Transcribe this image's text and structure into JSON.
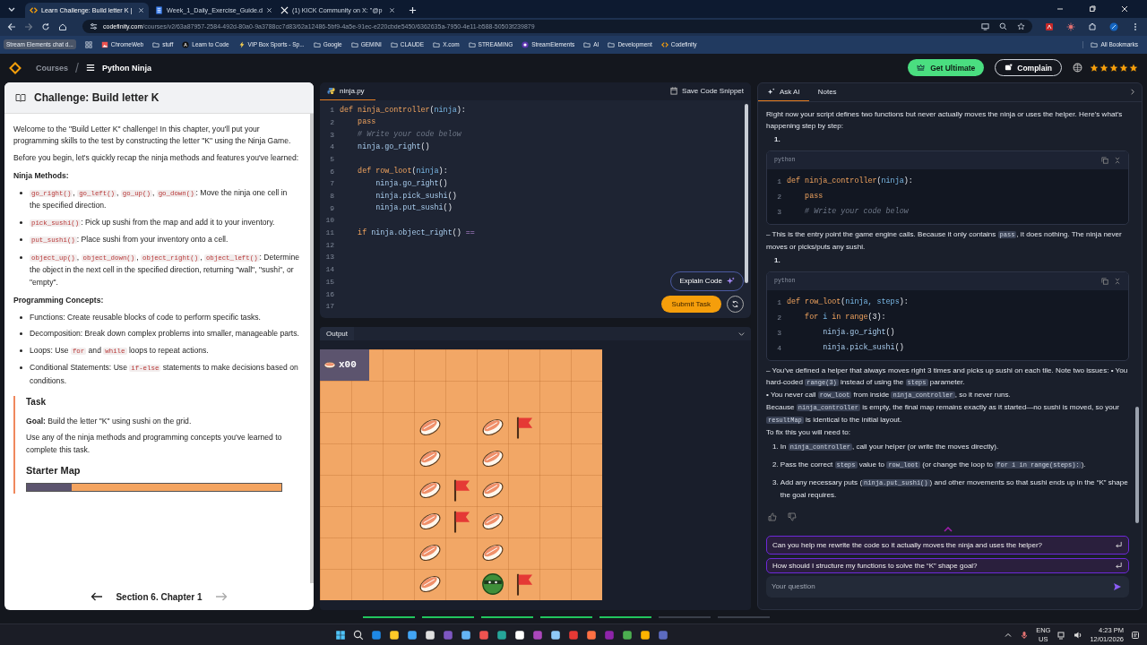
{
  "browser": {
    "tabs": [
      {
        "title": "Learn Challenge: Build letter K |",
        "selected": true,
        "kind": "code"
      },
      {
        "title": "Week_1_Daily_Exercise_Guide.d",
        "selected": false,
        "kind": "doc"
      },
      {
        "title": "(1) KICK Community on X: \"@p",
        "selected": false,
        "kind": "x"
      }
    ],
    "url": {
      "host": "codefinity.com",
      "path": "/courses/v2/63a87957-2584-492d-80a0-9a3788cc7d83/62a12486-5bf9-4a5e-91ec-e220cbde5450/6362635a-7950-4e11-b588-50503f239879"
    },
    "bookmarks": [
      {
        "label": "Stream Elements chat d...",
        "kind": "chip"
      },
      {
        "kind": "apps"
      },
      {
        "label": "ChromeWeb",
        "kind": "site"
      },
      {
        "label": "stuff",
        "kind": "folder"
      },
      {
        "label": "Learn to Code",
        "kind": "letter"
      },
      {
        "label": "VIP Box Sports - Sp...",
        "kind": "bolt"
      },
      {
        "label": "Google",
        "kind": "folder"
      },
      {
        "label": "GEMINI",
        "kind": "folder"
      },
      {
        "label": "CLAUDE",
        "kind": "folder"
      },
      {
        "label": "X.com",
        "kind": "folder"
      },
      {
        "label": "STREAMING",
        "kind": "folder"
      },
      {
        "label": "StreamElements",
        "kind": "circle"
      },
      {
        "label": "AI",
        "kind": "folder"
      },
      {
        "label": "Development",
        "kind": "folder"
      },
      {
        "label": "Codefinity",
        "kind": "code"
      }
    ],
    "all_bookmarks": "All Bookmarks"
  },
  "header": {
    "courses": "Courses",
    "separator": "/",
    "course": "Python Ninja",
    "ultimate": "Get Ultimate",
    "complain": "Complain",
    "stars": 5
  },
  "lesson": {
    "title": "Challenge: Build letter K",
    "blocks": [
      {
        "kind": "p",
        "parts": [
          {
            "text": "Welcome to the \"Build Letter K\" challenge! In this chapter, you'll put your programming skills to the test by constructing the letter \"K\" using the Ninja Game."
          }
        ]
      },
      {
        "kind": "p",
        "parts": [
          {
            "text": "Before you begin, let's quickly recap the ninja methods and features you've learned:"
          }
        ]
      },
      {
        "kind": "h",
        "parts": [
          {
            "text": "Ninja Methods:"
          }
        ]
      },
      {
        "kind": "li",
        "parts": [
          {
            "code": "go_right()"
          },
          {
            "text": ", "
          },
          {
            "code": "go_left()"
          },
          {
            "text": ", "
          },
          {
            "code": "go_up()"
          },
          {
            "text": ", "
          },
          {
            "code": "go_down()"
          },
          {
            "text": ": Move the ninja one cell in the specified direction."
          }
        ]
      },
      {
        "kind": "li",
        "parts": [
          {
            "code": "pick_sushi()"
          },
          {
            "text": ": Pick up sushi from the map and add it to your inventory."
          }
        ]
      },
      {
        "kind": "li",
        "parts": [
          {
            "code": "put_sushi()"
          },
          {
            "text": ": Place sushi from your inventory onto a cell."
          }
        ]
      },
      {
        "kind": "li",
        "parts": [
          {
            "code": "object_up()"
          },
          {
            "text": ", "
          },
          {
            "code": "object_down()"
          },
          {
            "text": ", "
          },
          {
            "code": "object_right()"
          },
          {
            "text": ", "
          },
          {
            "code": "object_left()"
          },
          {
            "text": ": Determine the object in the next cell in the specified direction, returning \"wall\", \"sushi\", or \"empty\"."
          }
        ]
      },
      {
        "kind": "h",
        "parts": [
          {
            "text": "Programming Concepts:"
          }
        ]
      },
      {
        "kind": "li",
        "parts": [
          {
            "text": "Functions: Create reusable blocks of code to perform specific tasks."
          }
        ]
      },
      {
        "kind": "li",
        "parts": [
          {
            "text": "Decomposition: Break down complex problems into smaller, manageable parts."
          }
        ]
      },
      {
        "kind": "li",
        "parts": [
          {
            "text": "Loops: Use "
          },
          {
            "code": "for"
          },
          {
            "text": " and "
          },
          {
            "code": "while"
          },
          {
            "text": " loops to repeat actions."
          }
        ]
      },
      {
        "kind": "li",
        "parts": [
          {
            "text": "Conditional Statements: Use "
          },
          {
            "code": "if-else"
          },
          {
            "text": " statements to make decisions based on conditions."
          }
        ]
      }
    ],
    "task": {
      "title": "Task",
      "goal": "**Goal:** Build the letter \"K\" using sushi on the grid.",
      "text": "Use any of the ninja methods and programming concepts you've learned to complete this task.",
      "map_title": "Starter Map"
    },
    "nav": {
      "label": "Section 6. Chapter 1",
      "prev_disabled": false,
      "next_disabled": true
    }
  },
  "editor": {
    "file": "ninja.py",
    "save": "Save Code Snippet",
    "explain": "Explain Code",
    "submit": "Submit Task",
    "lines": [
      {
        "n": "1",
        "code": [
          {
            "kind": "kw",
            "text": "def "
          },
          {
            "kind": "fn",
            "text": "ninja_controller"
          },
          {
            "kind": "p",
            "text": "("
          },
          {
            "kind": "var",
            "text": "ninja"
          },
          {
            "kind": "p",
            "text": "):"
          }
        ]
      },
      {
        "n": "2",
        "code": [
          {
            "kind": "kw",
            "text": "    pass"
          }
        ]
      },
      {
        "n": "3",
        "code": [
          {
            "kind": "cm",
            "text": "    # Write your code below"
          }
        ]
      },
      {
        "n": "4",
        "code": [
          {
            "kind": "call",
            "text": "    ninja.go_right"
          },
          {
            "kind": "p",
            "text": "()"
          }
        ]
      },
      {
        "n": "5"
      },
      {
        "n": "6",
        "code": [
          {
            "kind": "kw",
            "text": "    def "
          },
          {
            "kind": "fn",
            "text": "row_loot"
          },
          {
            "kind": "p",
            "text": "("
          },
          {
            "kind": "var",
            "text": "ninja"
          },
          {
            "kind": "p",
            "text": "):"
          }
        ]
      },
      {
        "n": "7",
        "code": [
          {
            "kind": "call",
            "text": "        ninja.go_right"
          },
          {
            "kind": "p",
            "text": "()"
          }
        ]
      },
      {
        "n": "8",
        "code": [
          {
            "kind": "call",
            "text": "        ninja.pick_sushi"
          },
          {
            "kind": "p",
            "text": "()"
          }
        ]
      },
      {
        "n": "9",
        "code": [
          {
            "kind": "call",
            "text": "        ninja.put_sushi"
          },
          {
            "kind": "p",
            "text": "()"
          }
        ]
      },
      {
        "n": "10"
      },
      {
        "n": "11",
        "code": [
          {
            "kind": "kw",
            "text": "    if "
          },
          {
            "kind": "call",
            "text": "ninja.object_right"
          },
          {
            "kind": "p",
            "text": "() "
          },
          {
            "kind": "op",
            "text": "=="
          }
        ]
      },
      {
        "n": "12"
      },
      {
        "n": "13"
      },
      {
        "n": "14"
      },
      {
        "n": "15"
      },
      {
        "n": "16"
      },
      {
        "n": "17"
      }
    ]
  },
  "output": {
    "title": "Output",
    "counter": "x00",
    "grid": [
      [
        {
          "kind": "empty"
        },
        {
          "kind": "empty"
        },
        {
          "kind": "empty"
        },
        {
          "kind": "empty"
        },
        {
          "kind": "empty"
        },
        {
          "kind": "empty"
        },
        {
          "kind": "empty"
        },
        {
          "kind": "empty"
        },
        {
          "kind": "empty"
        }
      ],
      [
        {
          "kind": "empty"
        },
        {
          "kind": "empty"
        },
        {
          "kind": "empty"
        },
        {
          "kind": "empty"
        },
        {
          "kind": "empty"
        },
        {
          "kind": "empty"
        },
        {
          "kind": "empty"
        },
        {
          "kind": "empty"
        },
        {
          "kind": "empty"
        }
      ],
      [
        {
          "kind": "empty"
        },
        {
          "kind": "empty"
        },
        {
          "kind": "empty"
        },
        {
          "kind": "sushi"
        },
        {
          "kind": "empty"
        },
        {
          "kind": "sushi"
        },
        {
          "kind": "flag"
        },
        {
          "kind": "empty"
        },
        {
          "kind": "empty"
        }
      ],
      [
        {
          "kind": "empty"
        },
        {
          "kind": "empty"
        },
        {
          "kind": "empty"
        },
        {
          "kind": "sushi"
        },
        {
          "kind": "empty"
        },
        {
          "kind": "sushi"
        },
        {
          "kind": "empty"
        },
        {
          "kind": "empty"
        },
        {
          "kind": "empty"
        }
      ],
      [
        {
          "kind": "empty"
        },
        {
          "kind": "empty"
        },
        {
          "kind": "empty"
        },
        {
          "kind": "sushi"
        },
        {
          "kind": "flag"
        },
        {
          "kind": "sushi"
        },
        {
          "kind": "empty"
        },
        {
          "kind": "empty"
        },
        {
          "kind": "empty"
        }
      ],
      [
        {
          "kind": "empty"
        },
        {
          "kind": "empty"
        },
        {
          "kind": "empty"
        },
        {
          "kind": "sushi"
        },
        {
          "kind": "flag"
        },
        {
          "kind": "sushi"
        },
        {
          "kind": "empty"
        },
        {
          "kind": "empty"
        },
        {
          "kind": "empty"
        }
      ],
      [
        {
          "kind": "empty"
        },
        {
          "kind": "empty"
        },
        {
          "kind": "empty"
        },
        {
          "kind": "sushi"
        },
        {
          "kind": "empty"
        },
        {
          "kind": "sushi"
        },
        {
          "kind": "empty"
        },
        {
          "kind": "empty"
        },
        {
          "kind": "empty"
        }
      ],
      [
        {
          "kind": "empty"
        },
        {
          "kind": "empty"
        },
        {
          "kind": "empty"
        },
        {
          "kind": "sushi"
        },
        {
          "kind": "empty"
        },
        {
          "kind": "ninja"
        },
        {
          "kind": "flag"
        },
        {
          "kind": "empty"
        },
        {
          "kind": "empty"
        }
      ]
    ]
  },
  "assistant": {
    "tabs": [
      {
        "label": "Ask AI",
        "selected": true
      },
      {
        "label": "Notes",
        "selected": false
      }
    ],
    "blocks": [
      {
        "kind": "p",
        "parts": [
          {
            "text": "Right now your script defines two functions but never actually moves the ninja or uses the helper. Here’s what’s happening step by step:"
          }
        ]
      },
      {
        "kind": "marker",
        "text": "1."
      },
      {
        "kind": "code",
        "lang": "python",
        "lines": [
          {
            "n": "1",
            "code": [
              {
                "kind": "kw",
                "text": "def "
              },
              {
                "kind": "fn",
                "text": "ninja_controller"
              },
              {
                "kind": "p",
                "text": "("
              },
              {
                "kind": "var",
                "text": "ninja"
              },
              {
                "kind": "p",
                "text": "):"
              }
            ]
          },
          {
            "n": "2",
            "code": [
              {
                "kind": "kw",
                "text": "    pass"
              }
            ]
          },
          {
            "n": "3",
            "code": [
              {
                "kind": "cm",
                "text": "    # Write your code below"
              }
            ]
          }
        ]
      },
      {
        "kind": "p",
        "parts": [
          {
            "text": "– This is the entry point the game engine calls. Because it only contains "
          },
          {
            "code": "pass"
          },
          {
            "text": ", it does nothing. The ninja never moves or picks/puts any sushi."
          }
        ]
      },
      {
        "kind": "marker",
        "text": "1."
      },
      {
        "kind": "code",
        "lang": "python",
        "lines": [
          {
            "n": "1",
            "code": [
              {
                "kind": "kw",
                "text": "def "
              },
              {
                "kind": "fn",
                "text": "row_loot"
              },
              {
                "kind": "p",
                "text": "("
              },
              {
                "kind": "var",
                "text": "ninja, steps"
              },
              {
                "kind": "p",
                "text": "):"
              }
            ]
          },
          {
            "n": "2",
            "code": [
              {
                "kind": "kw",
                "text": "    for "
              },
              {
                "kind": "var",
                "text": "i "
              },
              {
                "kind": "kw",
                "text": "in range"
              },
              {
                "kind": "p",
                "text": "(3):"
              }
            ]
          },
          {
            "n": "3",
            "code": [
              {
                "kind": "call",
                "text": "        ninja.go_right"
              },
              {
                "kind": "p",
                "text": "()"
              }
            ]
          },
          {
            "n": "4",
            "code": [
              {
                "kind": "call",
                "text": "        ninja.pick_sushi"
              },
              {
                "kind": "p",
                "text": "()"
              }
            ]
          }
        ]
      },
      {
        "kind": "p",
        "parts": [
          {
            "text": "– You’ve defined a helper that always moves right 3 times and picks up sushi on each tile. Note two issues: • You hard-coded "
          },
          {
            "code": "range(3)"
          },
          {
            "text": " instead of using the "
          },
          {
            "code": "steps"
          },
          {
            "text": " parameter."
          }
        ]
      },
      {
        "kind": "p",
        "parts": [
          {
            "text": "• You never call "
          },
          {
            "code": "row_loot"
          },
          {
            "text": " from inside "
          },
          {
            "code": "ninja_controller"
          },
          {
            "text": ", so it never runs."
          }
        ]
      },
      {
        "kind": "p",
        "parts": [
          {
            "text": "Because "
          },
          {
            "code": "ninja_controller"
          },
          {
            "text": " is empty, the final map remains exactly as it started—no sushi is moved, so your "
          },
          {
            "code": "resultMap"
          },
          {
            "text": " is identical to the initial layout."
          }
        ]
      },
      {
        "kind": "p",
        "parts": [
          {
            "text": "To fix this you will need to:"
          }
        ]
      },
      {
        "kind": "ol",
        "n": "1.",
        "parts": [
          {
            "text": "In "
          },
          {
            "code": "ninja_controller"
          },
          {
            "text": ", call your helper (or write the moves directly)."
          }
        ]
      },
      {
        "kind": "ol",
        "n": "2.",
        "parts": [
          {
            "text": "Pass the correct "
          },
          {
            "code": "steps"
          },
          {
            "text": " value to "
          },
          {
            "code": "row_loot"
          },
          {
            "text": " (or change the loop to "
          },
          {
            "code": "for i in range(steps):"
          },
          {
            "text": ")."
          }
        ]
      },
      {
        "kind": "ol",
        "n": "3.",
        "parts": [
          {
            "text": "Add any necessary puts ("
          },
          {
            "code": "ninja.put_sushi()"
          },
          {
            "text": ") and other movements so that sushi ends up in the “K” shape the goal requires."
          }
        ]
      }
    ],
    "suggestions": [
      "Can you help me rewrite the code so it actually moves the ninja and uses the helper?",
      "How should I structure my functions to solve the “K” shape goal?"
    ],
    "input": {
      "placeholder": "Your question"
    }
  },
  "progress": [
    {
      "done": true
    },
    {
      "done": true
    },
    {
      "done": true
    },
    {
      "done": true
    },
    {
      "done": true
    },
    {
      "done": false
    },
    {
      "done": false
    }
  ],
  "taskbar": {
    "language": "ENG",
    "region": "US",
    "time": "4:23 PM",
    "date": "12/01/2026"
  }
}
